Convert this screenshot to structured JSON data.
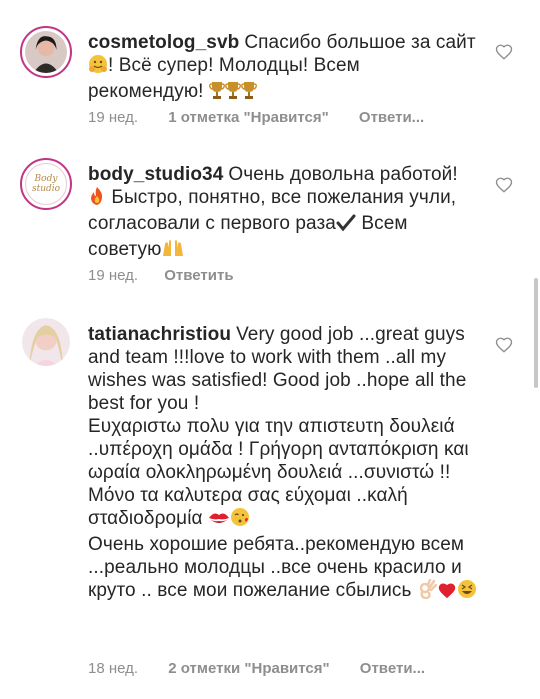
{
  "comments": [
    {
      "username": "cosmetolog_svb",
      "text_parts": [
        "Спасибо большое за сайт",
        "! Всё супер! Молодцы! Всем рекомендую!"
      ],
      "emoji_names": [
        "hugging-face-icon",
        "trophy-icon"
      ],
      "time": "19 нед.",
      "likes": "1 отметка \"Нравится\"",
      "reply": "Ответи..."
    },
    {
      "username": "body_studio34",
      "avatar_text": "Body studio",
      "text_parts": [
        "Очень довольна работой!",
        " Быстро, понятно, все пожелания учли, согласовали с первого раза",
        " Всем советую"
      ],
      "emoji_names": [
        "fire-icon",
        "check-mark-icon",
        "raised-hands-icon"
      ],
      "time": "19 нед.",
      "reply": "Ответить"
    },
    {
      "username": "tatianachristiou",
      "text_parts": [
        "Very good job ...great guys and team !!!love to work with them ..all my wishes was  satisfied! Good job ..hope all the best for you !",
        "Ευχαριστω πολυ για την απιστευτη δουλειά ..υπέροχη ομάδα ! Γρήγορη ανταπόκριση και ωραία ολοκληρωμένη δουλειά ...συνιστώ !!",
        "Μόνο τα καλυτερα σας εύχομαι ..καλή σταδιοδρομία",
        "Очень хорошие ребята..рекомендую всем ...реально молодцы ..все очень красило и круто .. все мои пожелание сбылись"
      ],
      "emoji_names": [
        "kiss-mark-icon",
        "face-blowing-kiss-icon",
        "ok-hand-icon",
        "red-heart-icon",
        "grinning-squinting-face-icon"
      ],
      "time": "18 нед.",
      "likes": "2 отметки \"Нравится\"",
      "reply": "Ответи..."
    }
  ],
  "colors": {
    "text": "#262626",
    "meta": "#8e8e8e",
    "ring": "#c13584"
  }
}
